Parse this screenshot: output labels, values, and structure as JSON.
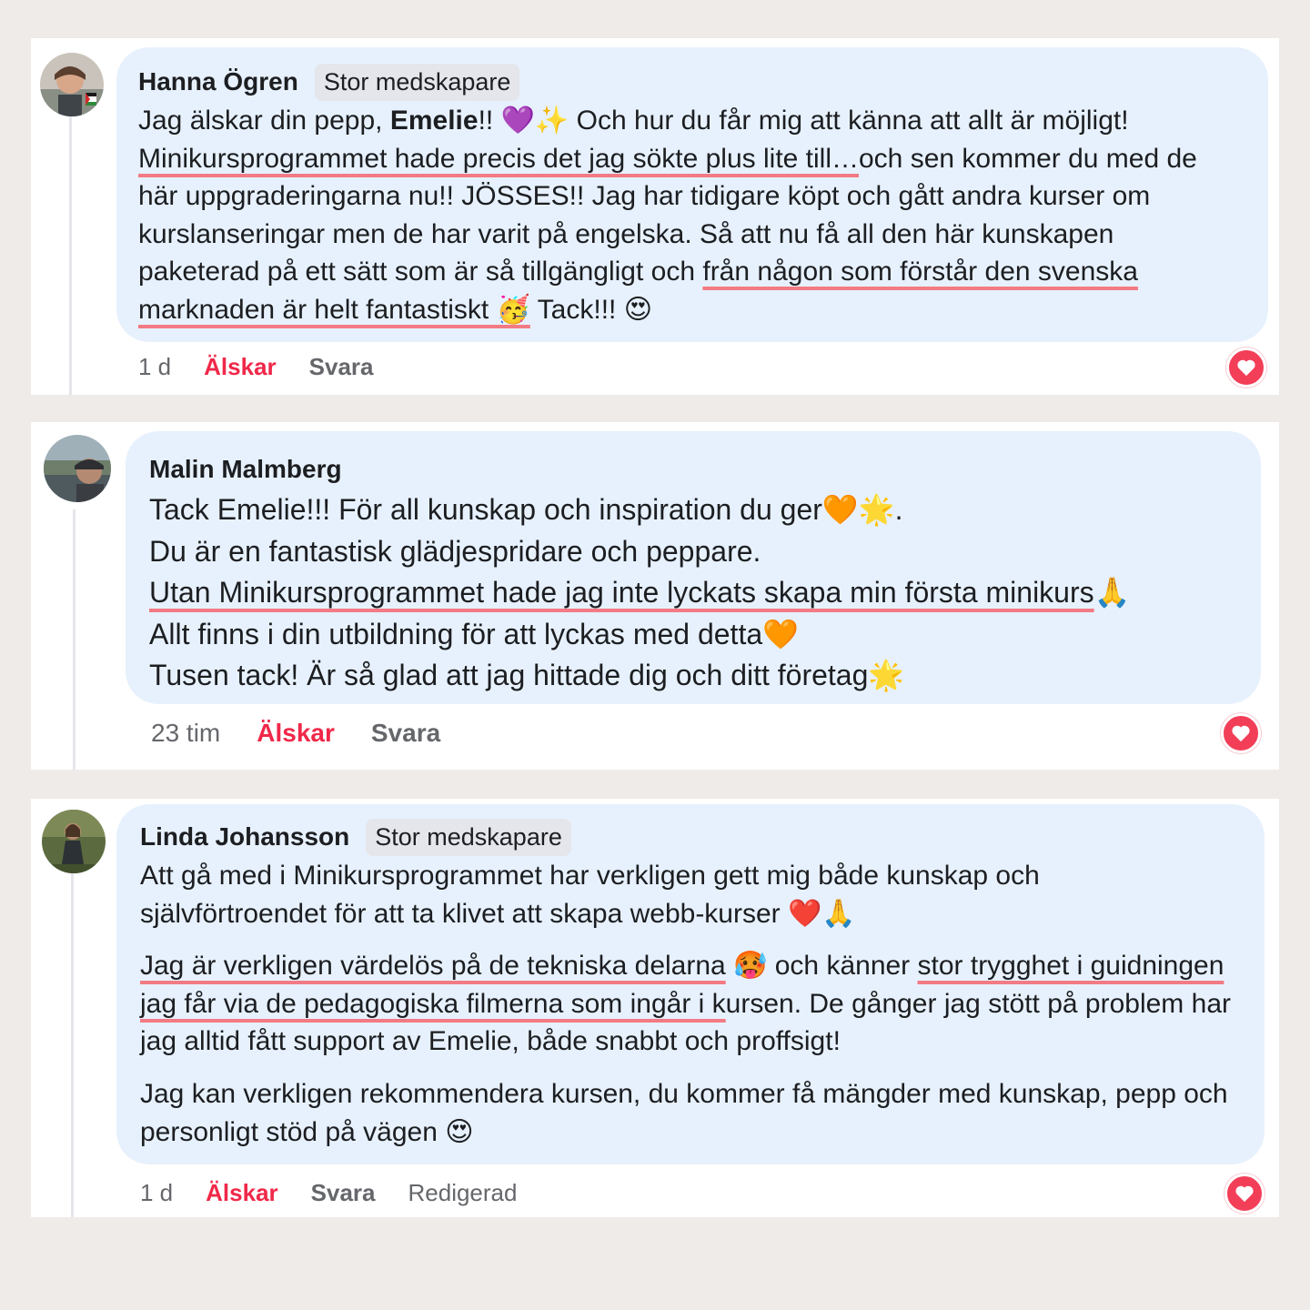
{
  "colors": {
    "page_bg": "#efebe9",
    "bubble_bg": "#e7f1fd",
    "love_red": "#f02849",
    "highlight_underline": "#f27b84",
    "badge_bg": "#e4e6eb"
  },
  "comments": [
    {
      "author": "Hanna Ögren",
      "badge": "Stor medskapare",
      "time": "1 d",
      "love": "Älskar",
      "reply": "Svara",
      "edited": "",
      "text": {
        "s1": "Jag älskar din pepp, ",
        "s2_bold": "Emelie",
        "s3": "!! 💜✨ Och hur du får mig att känna att allt är möjligt! ",
        "s4_hl": "Minikursprogrammet hade precis det jag sökte plus lite till…",
        "s5": "och sen kommer du med de här uppgraderingarna nu!! JÖSSES!! Jag har tidigare köpt och gått andra kurser om kurslanseringar men de har varit på engelska. Så att nu få all den här kunskapen paketerad på ett sätt som är så tillgängligt och ",
        "s6_hl": "från någon som förstår den svenska marknaden är helt fantastiskt 🥳",
        "s7": " Tack!!! 😍"
      }
    },
    {
      "author": "Malin Malmberg",
      "badge": "",
      "time": "23 tim",
      "love": "Älskar",
      "reply": "Svara",
      "edited": "",
      "lines": {
        "l1": "Tack Emelie!!! För all kunskap och inspiration du ger🧡🌟.",
        "l2": "Du är en fantastisk glädjespridare och peppare.",
        "l3_hl": "Utan Minikursprogrammet hade jag inte lyckats skapa min första minikurs",
        "l3_tail": "🙏",
        "l4": "Allt finns i din utbildning för att lyckas med detta🧡",
        "l5": "Tusen tack! Är så glad att jag hittade dig och ditt företag🌟"
      }
    },
    {
      "author": "Linda Johansson",
      "badge": "Stor medskapare",
      "time": "1 d",
      "love": "Älskar",
      "reply": "Svara",
      "edited": "Redigerad",
      "paras": {
        "p1": "Att gå med i Minikursprogrammet har verkligen gett mig både kunskap och självförtroendet för att ta klivet att skapa webb-kurser ❤️🙏",
        "p2_hl1": "Jag är verkligen värdelös på de tekniska delarna",
        "p2_s1": " 🥵 och känner ",
        "p2_hl2": "stor trygghet i guidningen jag får via de pedagogiska filmerna som ingår i k",
        "p2_s2": "ursen. De gånger jag stött på problem har jag alltid fått support av Emelie, både snabbt och proffsigt!",
        "p3": "Jag kan verkligen rekommendera kursen, du kommer få mängder med kunskap, pepp och personligt stöd på vägen 😍"
      }
    }
  ],
  "icons": {
    "heart": "heart-icon",
    "avatar": "avatar-photo"
  }
}
